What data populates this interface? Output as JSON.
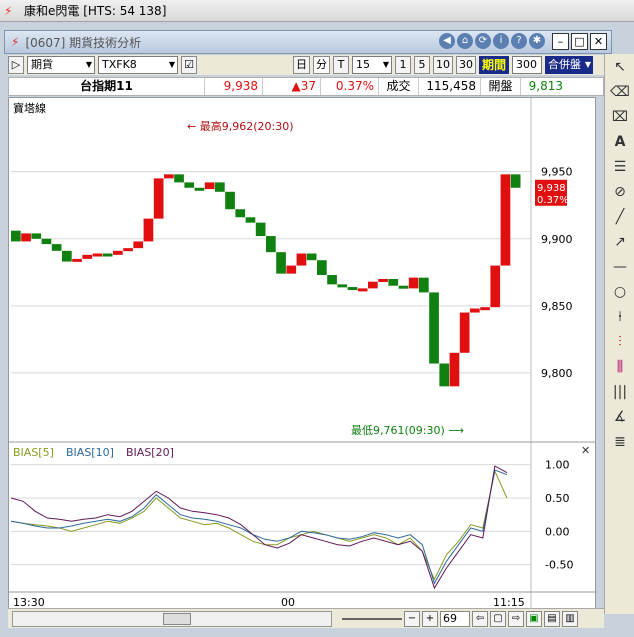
{
  "app": {
    "title": "康和e閃電 [HTS: 54 138]",
    "window_title": "[0607] 期貨技術分析"
  },
  "toolbar": {
    "market": "期貨",
    "symbol": "TXFK8",
    "period_buttons": [
      "日",
      "分",
      "T"
    ],
    "interval": "15",
    "quick_intervals": [
      "1",
      "5",
      "10",
      "30"
    ],
    "period_label": "期間",
    "period_value": "300",
    "merge_label": "合併盤"
  },
  "quote": {
    "name": "台指期11",
    "price": "9,938",
    "change": "▲37",
    "change_pct": "0.37%",
    "volume_label": "成交量",
    "volume": "115,458",
    "open_label": "開盤價",
    "open": "9,813"
  },
  "colors": {
    "up": "#e01010",
    "down": "#108010",
    "bias5": "#8a9a20",
    "bias10": "#2a6a9a",
    "bias20": "#601858"
  },
  "chart_data": [
    {
      "type": "line",
      "title": "寶塔線",
      "ylim": [
        9750,
        9990
      ],
      "yticks": [
        9800,
        9850,
        9900,
        9950
      ],
      "ytick_labels": [
        "9,800",
        "9,850",
        "9,900",
        "9,950"
      ],
      "xtick_labels": [
        "13:30",
        "00",
        "11:15"
      ],
      "annotations": {
        "high": "← 最高9,962(20:30)",
        "low": "最低9,761(09:30) ⟶"
      },
      "last_price_label": "9,938",
      "last_pct_label": "0.37%",
      "values": [
        9898,
        9904,
        9900,
        9896,
        9891,
        9883,
        9885,
        9888,
        9889,
        9888,
        9891,
        9893,
        9898,
        9915,
        9945,
        9948,
        9942,
        9938,
        9937,
        9942,
        9935,
        9922,
        9916,
        9912,
        9902,
        9890,
        9874,
        9880,
        9889,
        9884,
        9873,
        9866,
        9864,
        9862,
        9863,
        9868,
        9870,
        9865,
        9863,
        9871,
        9860,
        9807,
        9790,
        9815,
        9845,
        9848,
        9849,
        9880,
        9948,
        9938
      ]
    },
    {
      "type": "line",
      "title": "",
      "legend": [
        "BIAS[5]",
        "BIAS[10]",
        "BIAS[20]"
      ],
      "ylim": [
        -0.85,
        1.1
      ],
      "yticks": [
        -0.5,
        0.0,
        0.5,
        1.0
      ],
      "ytick_labels": [
        "-0.50",
        "0.00",
        "0.50",
        "1.00"
      ],
      "series": [
        {
          "name": "BIAS[5]",
          "values": [
            0.15,
            0.12,
            0.1,
            0.08,
            0.05,
            0.0,
            0.05,
            0.1,
            0.15,
            0.12,
            0.2,
            0.3,
            0.5,
            0.35,
            0.2,
            0.15,
            0.1,
            0.12,
            0.05,
            -0.05,
            -0.15,
            -0.2,
            -0.2,
            -0.1,
            -0.05,
            0.0,
            -0.05,
            -0.1,
            -0.15,
            -0.1,
            -0.05,
            -0.1,
            -0.2,
            -0.1,
            -0.3,
            -0.72,
            -0.35,
            -0.15,
            0.1,
            0.05,
            0.9,
            0.5
          ]
        },
        {
          "name": "BIAS[10]",
          "values": [
            0.15,
            0.12,
            0.08,
            0.05,
            0.05,
            0.08,
            0.12,
            0.15,
            0.18,
            0.15,
            0.22,
            0.35,
            0.55,
            0.4,
            0.25,
            0.2,
            0.18,
            0.15,
            0.1,
            0.05,
            -0.05,
            -0.12,
            -0.15,
            -0.1,
            0.0,
            -0.02,
            -0.05,
            -0.1,
            -0.12,
            -0.08,
            -0.02,
            -0.05,
            -0.1,
            -0.05,
            -0.2,
            -0.78,
            -0.45,
            -0.2,
            0.05,
            0.0,
            0.92,
            0.85
          ]
        },
        {
          "name": "BIAS[20]",
          "values": [
            0.5,
            0.45,
            0.3,
            0.2,
            0.18,
            0.15,
            0.18,
            0.2,
            0.25,
            0.22,
            0.3,
            0.45,
            0.6,
            0.5,
            0.35,
            0.3,
            0.28,
            0.25,
            0.2,
            0.1,
            -0.05,
            -0.2,
            -0.25,
            -0.18,
            -0.05,
            -0.1,
            -0.15,
            -0.2,
            -0.22,
            -0.15,
            -0.1,
            -0.15,
            -0.2,
            -0.15,
            -0.3,
            -0.85,
            -0.55,
            -0.3,
            -0.05,
            -0.1,
            0.98,
            0.88
          ]
        }
      ]
    }
  ],
  "bottom": {
    "zoom": "69"
  }
}
